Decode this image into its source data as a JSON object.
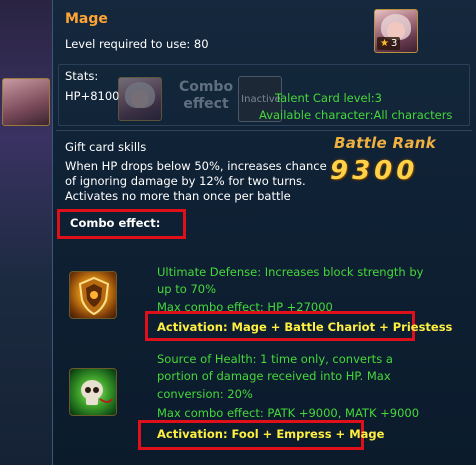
{
  "card": {
    "title": "Mage",
    "level_required": "Level required to use: 80",
    "stars": "3"
  },
  "stats": {
    "label": "Stats:",
    "hp": "HP+8100",
    "combo_label": "Combo effect",
    "inactive": "Inactive",
    "talent": "Talent Card level:3",
    "available": "Available character:All characters"
  },
  "gift": {
    "label": "Gift card skills",
    "desc_line1": "When HP drops below 50%, increases chance",
    "desc_line2": "of ignoring damage by 12% for two turns.",
    "desc_line3": "Activates no more than once per battle"
  },
  "battle_rank": {
    "label": "Battle Rank",
    "value": "9300"
  },
  "combo_effect_label": "Combo effect:",
  "skills": [
    {
      "icon": "shield-icon",
      "line1": "Ultimate Defense: Increases block strength by",
      "line2": "up to 70%",
      "line3": "Max combo effect: HP +27000",
      "activation": "Activation: Mage + Battle Chariot + Priestess"
    },
    {
      "icon": "skull-icon",
      "line1": "Source of Health: 1 time only, converts a",
      "line2": "portion of damage received into HP. Max",
      "line3": "conversion: 20%",
      "line4": "Max combo effect: PATK +9000, MATK +9000",
      "activation": "Activation: Fool + Empress + Mage"
    }
  ],
  "colors": {
    "title": "#ffa535",
    "green_text": "#45d83a",
    "yellow_text": "#fff040",
    "highlight_box": "#e0101a"
  }
}
